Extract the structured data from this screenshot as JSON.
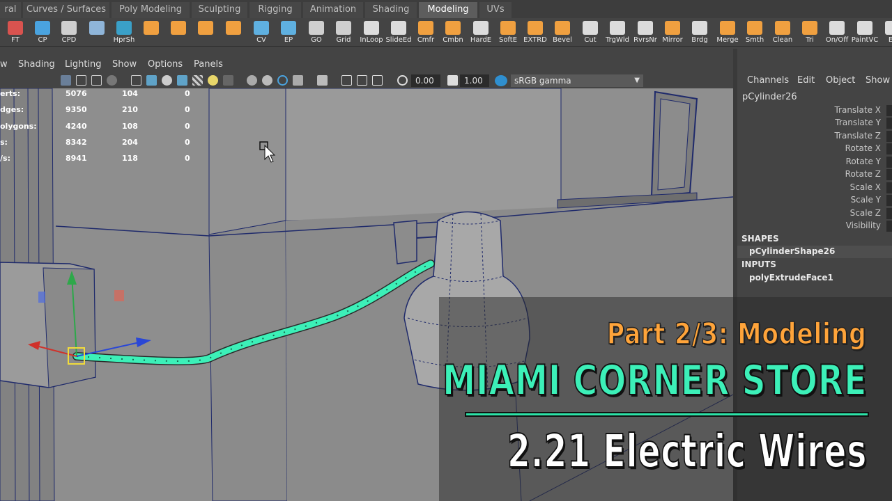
{
  "shelf_tabs": [
    {
      "label": "ral"
    },
    {
      "label": "Curves / Surfaces"
    },
    {
      "label": "Poly Modeling"
    },
    {
      "label": "Sculpting"
    },
    {
      "label": "Rigging"
    },
    {
      "label": "Animation"
    },
    {
      "label": "Shading"
    },
    {
      "label": "Modeling"
    },
    {
      "label": "UVs"
    }
  ],
  "active_tab": "Modeling",
  "shelf_tools": [
    {
      "label": "FT",
      "icon": "freeze-transform-icon",
      "color": "#d9534f"
    },
    {
      "label": "CP",
      "icon": "center-pivot-icon",
      "color": "#4aa3df"
    },
    {
      "label": "CPD",
      "icon": "eye-icon",
      "color": "#cfcfcf"
    },
    {
      "label": "",
      "icon": "uv-editor-icon",
      "color": "#8fb5d9"
    },
    {
      "label": "HprSh",
      "icon": "hypershade-icon",
      "color": "#3aa0c8"
    },
    {
      "label": "",
      "icon": "poly-cube-icon",
      "color": "#f0a040"
    },
    {
      "label": "",
      "icon": "poly-cylinder-icon",
      "color": "#f0a040"
    },
    {
      "label": "",
      "icon": "poly-sphere-icon",
      "color": "#f0a040"
    },
    {
      "label": "",
      "icon": "poly-plane-icon",
      "color": "#f0a040"
    },
    {
      "label": "CV",
      "icon": "cv-curve-icon",
      "color": "#5fb0e0"
    },
    {
      "label": "EP",
      "icon": "ep-curve-icon",
      "color": "#5fb0e0"
    },
    {
      "label": "GO",
      "icon": "eye-icon",
      "color": "#cfcfcf"
    },
    {
      "label": "Grid",
      "icon": "eye-icon",
      "color": "#cfcfcf"
    },
    {
      "label": "InLoop",
      "icon": "insert-loop-icon",
      "color": "#dcdcdc"
    },
    {
      "label": "SlideEd",
      "icon": "slide-edge-icon",
      "color": "#dcdcdc"
    },
    {
      "label": "Cmfr",
      "icon": "chamfer-icon",
      "color": "#f0a040"
    },
    {
      "label": "Cmbn",
      "icon": "combine-icon",
      "color": "#f0a040"
    },
    {
      "label": "HardE",
      "icon": "hard-edge-icon",
      "color": "#dcdcdc"
    },
    {
      "label": "SoftE",
      "icon": "soft-edge-icon",
      "color": "#f0a040"
    },
    {
      "label": "EXTRD",
      "icon": "extrude-icon",
      "color": "#f0a040"
    },
    {
      "label": "Bevel",
      "icon": "bevel-icon",
      "color": "#f0a040"
    },
    {
      "label": "Cut",
      "icon": "cut-icon",
      "color": "#dcdcdc"
    },
    {
      "label": "TrgWld",
      "icon": "target-weld-icon",
      "color": "#dcdcdc"
    },
    {
      "label": "RvrsNr",
      "icon": "reverse-normals-icon",
      "color": "#dcdcdc"
    },
    {
      "label": "Mirror",
      "icon": "mirror-icon",
      "color": "#f0a040"
    },
    {
      "label": "Brdg",
      "icon": "bridge-icon",
      "color": "#dcdcdc"
    },
    {
      "label": "Merge",
      "icon": "merge-icon",
      "color": "#f0a040"
    },
    {
      "label": "Smth",
      "icon": "smooth-icon",
      "color": "#f0a040"
    },
    {
      "label": "Clean",
      "icon": "cleanup-icon",
      "color": "#f0a040"
    },
    {
      "label": "Tri",
      "icon": "triangulate-icon",
      "color": "#f0a040"
    },
    {
      "label": "On/Off",
      "icon": "toggle-icon",
      "color": "#dcdcdc"
    },
    {
      "label": "PaintVC",
      "icon": "paint-vertex-color-icon",
      "color": "#dcdcdc"
    },
    {
      "label": "Ex",
      "icon": "export-icon",
      "color": "#dcdcdc"
    }
  ],
  "panel_menu": [
    "w",
    "Shading",
    "Lighting",
    "Show",
    "Options",
    "Panels"
  ],
  "toolbar": {
    "exposure_value": "0.00",
    "gamma_value": "1.00",
    "color_space": "sRGB gamma"
  },
  "hud": {
    "rows": [
      {
        "label": "erts:",
        "a": "5076",
        "b": "104",
        "c": "0"
      },
      {
        "label": "dges:",
        "a": "9350",
        "b": "210",
        "c": "0"
      },
      {
        "label": "olygons:",
        "a": "4240",
        "b": "108",
        "c": "0"
      },
      {
        "label": "s:",
        "a": "8342",
        "b": "204",
        "c": "0"
      },
      {
        "label": "/s:",
        "a": "8941",
        "b": "118",
        "c": "0"
      }
    ]
  },
  "channel_box": {
    "menu": [
      "Channels",
      "Edit",
      "Object",
      "Show"
    ],
    "object": "pCylinder26",
    "attributes": [
      "Translate X",
      "Translate Y",
      "Translate Z",
      "Rotate X",
      "Rotate Y",
      "Rotate Z",
      "Scale X",
      "Scale Y",
      "Scale Z",
      "Visibility"
    ],
    "shapes_header": "SHAPES",
    "shape": "pCylinderShape26",
    "inputs_header": "INPUTS",
    "input": "polyExtrudeFace1"
  },
  "title_card": {
    "part": "Part 2/3: Modeling",
    "series": "MIAMI CORNER STORE",
    "episode": "2.21 Electric Wires"
  },
  "colors": {
    "accent_teal": "#3cf0b8",
    "accent_orange": "#ffa43a",
    "selection_wire": "#3cf0b8",
    "ui_bg": "#444444",
    "viewport_bg": "#8a8a8a"
  }
}
